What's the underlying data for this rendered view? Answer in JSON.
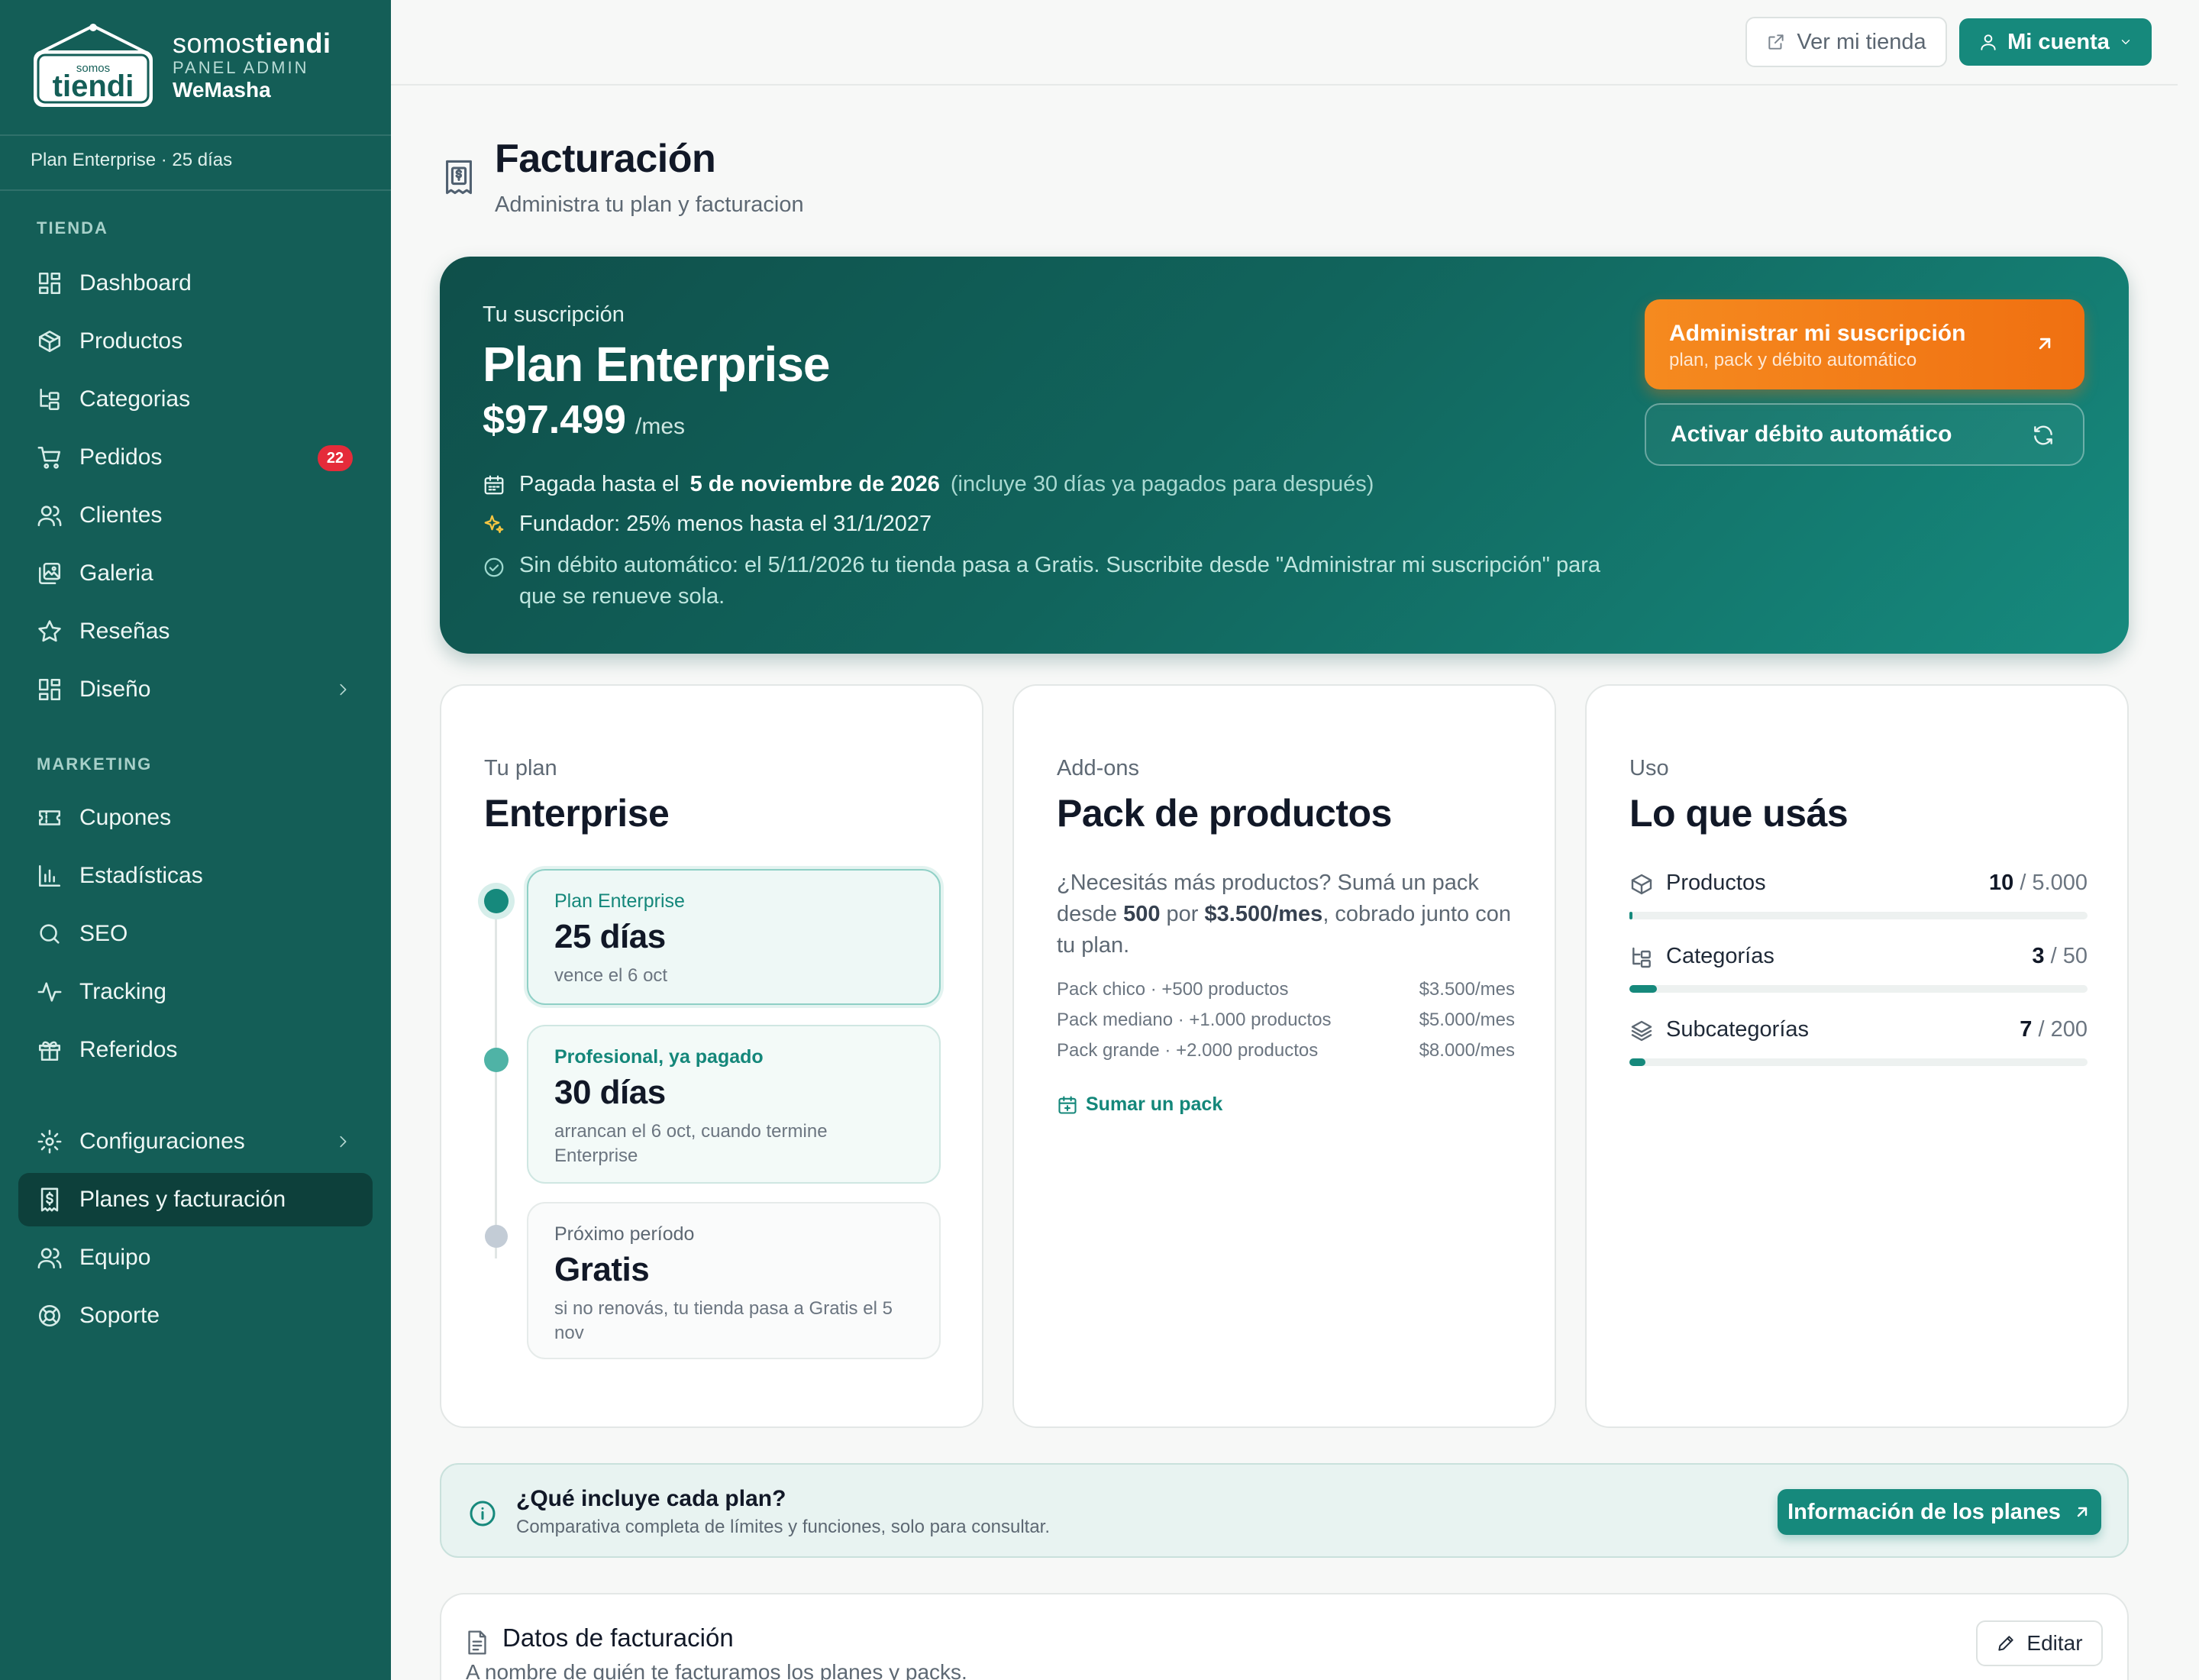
{
  "brand": {
    "name_light": "somos",
    "name_bold": "tiendi",
    "subtitle": "PANEL ADMIN",
    "store": "WeMasha",
    "logo_small": "somos",
    "logo_big": "tiendi"
  },
  "sidebar": {
    "plan_line": "Plan Enterprise · 25 días",
    "sections": [
      {
        "title": "TIENDA"
      },
      {
        "title": "MARKETING"
      }
    ],
    "items": [
      {
        "label": "Dashboard",
        "icon": "dashboard-icon"
      },
      {
        "label": "Productos",
        "icon": "box-icon"
      },
      {
        "label": "Categorias",
        "icon": "category-tree-icon"
      },
      {
        "label": "Pedidos",
        "icon": "cart-icon",
        "badge": "22"
      },
      {
        "label": "Clientes",
        "icon": "users-icon"
      },
      {
        "label": "Galeria",
        "icon": "gallery-icon"
      },
      {
        "label": "Reseñas",
        "icon": "star-icon"
      },
      {
        "label": "Diseño",
        "icon": "layout-icon"
      },
      {
        "label": "Cupones",
        "icon": "ticket-icon"
      },
      {
        "label": "Estadísticas",
        "icon": "bar-chart-icon"
      },
      {
        "label": "SEO",
        "icon": "search-icon"
      },
      {
        "label": "Tracking",
        "icon": "activity-icon"
      },
      {
        "label": "Referidos",
        "icon": "gift-icon"
      },
      {
        "label": "Configuraciones",
        "icon": "gear-icon"
      },
      {
        "label": "Planes y facturación",
        "icon": "receipt-icon"
      },
      {
        "label": "Equipo",
        "icon": "team-icon"
      },
      {
        "label": "Soporte",
        "icon": "lifebuoy-icon"
      }
    ]
  },
  "topbar": {
    "store_label": "Ver mi tienda",
    "account_label": "Mi cuenta"
  },
  "page": {
    "title": "Facturación",
    "subtitle": "Administra tu plan y facturacion"
  },
  "hero": {
    "kicker": "Tu suscripción",
    "plan": "Plan Enterprise",
    "price": "$97.499",
    "per": "/mes",
    "paid_prefix": "Pagada hasta el",
    "paid_date": "5 de noviembre de 2026",
    "paid_note": "(incluye 30 días ya pagados para después)",
    "founder": "Fundador: 25% menos hasta el 31/1/2027",
    "warning": "Sin débito automático: el 5/11/2026 tu tienda pasa a Gratis. Suscribite desde \"Administrar mi suscripción\" para que se renueve sola.",
    "admin_title": "Administrar mi suscripción",
    "admin_sub": "plan, pack y débito automático",
    "auto_label": "Activar débito automático",
    "colors": {
      "accent_orange": "#f07011",
      "teal_dark": "#0f4f4a",
      "teal": "#168a7e"
    }
  },
  "plan_card": {
    "kicker": "Tu plan",
    "title": "Enterprise",
    "timeline": [
      {
        "kicker": "Plan Enterprise",
        "value": "25 días",
        "sub": "vence el 6 oct"
      },
      {
        "kicker": "Profesional, ya pagado",
        "value": "30 días",
        "sub": "arrancan el 6 oct, cuando termine Enterprise"
      },
      {
        "kicker": "Próximo período",
        "value": "Gratis",
        "sub": "si no renovás, tu tienda pasa a Gratis el 5 nov"
      }
    ]
  },
  "addons_card": {
    "kicker": "Add-ons",
    "title": "Pack de productos",
    "desc_1": "¿Necesitás más productos? Sumá un pack desde ",
    "desc_bold_1": "500",
    "desc_2": " por ",
    "desc_bold_2": "$3.500/mes",
    "desc_3": ", cobrado junto con tu plan.",
    "packs": [
      {
        "name": "Pack chico · +500 productos",
        "price": "$3.500/mes"
      },
      {
        "name": "Pack mediano · +1.000 productos",
        "price": "$5.000/mes"
      },
      {
        "name": "Pack grande · +2.000 productos",
        "price": "$8.000/mes"
      }
    ],
    "link": "Sumar un pack"
  },
  "usage_card": {
    "kicker": "Uso",
    "title": "Lo que usás",
    "rows": [
      {
        "name": "Productos",
        "used": "10",
        "limit": "/ 5.000",
        "fraction": 0.002
      },
      {
        "name": "Categorías",
        "used": "3",
        "limit": "/ 50",
        "fraction": 0.06
      },
      {
        "name": "Subcategorías",
        "used": "7",
        "limit": "/ 200",
        "fraction": 0.035
      }
    ]
  },
  "info": {
    "title": "¿Qué incluye cada plan?",
    "sub": "Comparativa completa de límites y funciones, solo para consultar.",
    "button": "Información de los planes"
  },
  "billing": {
    "title": "Datos de facturación",
    "sub": "A nombre de quién te facturamos los planes y packs.",
    "edit": "Editar"
  }
}
